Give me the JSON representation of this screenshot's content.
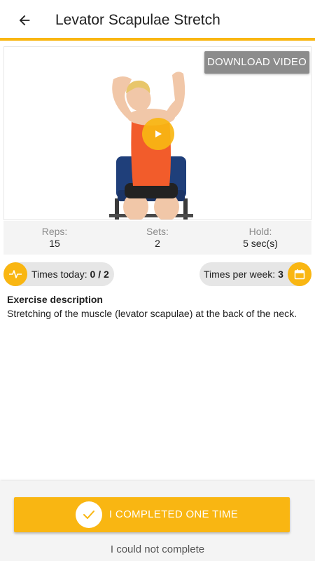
{
  "header": {
    "title": "Levator Scapulae Stretch",
    "back_icon": "arrow-back-icon",
    "accent_color": "#f9b612"
  },
  "video": {
    "download_label": "DOWNLOAD VIDEO",
    "play_icon": "play-icon"
  },
  "stats": [
    {
      "label": "Reps:",
      "value": "15"
    },
    {
      "label": "Sets:",
      "value": "2"
    },
    {
      "label": "Hold:",
      "value": "5 sec(s)"
    }
  ],
  "progress": {
    "today_label": "Times today:",
    "today_value": "0 / 2",
    "today_icon": "heartbeat-icon",
    "week_label": "Times per week:",
    "week_value": "3",
    "week_icon": "calendar-icon"
  },
  "description": {
    "title": "Exercise description",
    "text": "Stretching of the muscle (levator scapulae) at the back of the neck."
  },
  "actions": {
    "complete_label": "I COMPLETED ONE TIME",
    "complete_icon": "check-icon",
    "could_not_label": "I could not complete"
  }
}
